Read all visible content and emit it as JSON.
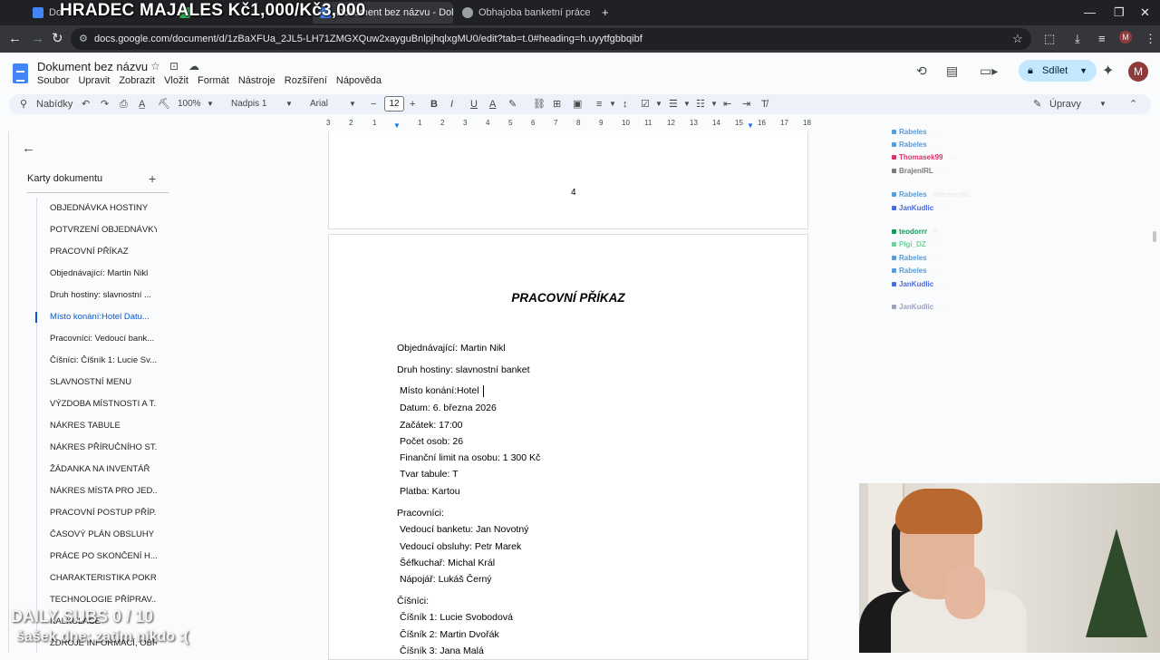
{
  "overlays": {
    "top_banner": "HRADEC MAJALES Kč1,000/Kč3,000",
    "daily_subs": "DAILY SUBS 0 / 10",
    "sasek": "šašek dne: zatím nikdo :("
  },
  "browser": {
    "tabs": [
      {
        "title": "Docu",
        "icon": "docs-icon",
        "active": false
      },
      {
        "title": "",
        "icon": "docs-icon",
        "active": false
      },
      {
        "title": "Dokument bez názvu - Dokum",
        "icon": "docs-icon",
        "active": true
      },
      {
        "title": "Obhajoba banketní práce",
        "icon": "globe-icon",
        "active": false
      }
    ],
    "new_tab": "+",
    "url": "docs.google.com/document/d/1zBaXFUa_2JL5-LH71ZMGXQuw2xayguBnlpjhqlxgMU0/edit?tab=t.0#heading=h.uyytfgbbqibf"
  },
  "docs": {
    "title": "Dokument bez názvu",
    "menu": [
      "Soubor",
      "Upravit",
      "Zobrazit",
      "Vložit",
      "Formát",
      "Nástroje",
      "Rozšíření",
      "Nápověda"
    ],
    "share_label": "Sdílet",
    "avatar_initial": "M",
    "toolbar": {
      "search_label": "Nabídky",
      "zoom": "100%",
      "style": "Nadpis 1",
      "font": "Arial",
      "font_size": "12",
      "mode": "Úpravy"
    },
    "ruler_ticks": [
      "3",
      "2",
      "1",
      "1",
      "2",
      "3",
      "4",
      "5",
      "6",
      "7",
      "8",
      "9",
      "10",
      "11",
      "12",
      "13",
      "14",
      "15",
      "16",
      "17",
      "18"
    ]
  },
  "outline": {
    "title": "Karty dokumentu",
    "items": [
      "OBJEDNÁVKA HOSTINY",
      "POTVRZENÍ OBJEDNÁVKY",
      "PRACOVNÍ PŘÍKAZ",
      "Objednávající: Martin Nikl",
      "Druh hostiny: slavnostní ...",
      "Místo konání:Hotel Datu...",
      "Pracovníci: Vedoucí bank...",
      "Číšníci: Číšník 1: Lucie Sv...",
      "SLAVNOSTNÍ MENU",
      "VÝZDOBA MÍSTNOSTI A T...",
      "NÁKRES TABULE",
      "NÁKRES PŘÍRUČNÍHO ST...",
      "ŽÁDANKA NA INVENTÁŘ",
      "NÁKRES MÍSTA PRO JED...",
      "PRACOVNÍ POSTUP PŘÍP...",
      "ČASOVÝ PLÁN OBSLUHY",
      "PRÁCE PO SKONČENÍ H...",
      "CHARAKTERISTIKA POKR...",
      "TECHNOLOGIE PŘÍPRAV...",
      "KALKULACE",
      "ZDROJE INFORMACÍ, OBR..."
    ],
    "active_index": 5
  },
  "document": {
    "page_number": "4",
    "heading": "PRACOVNÍ PŘÍKAZ",
    "lines": [
      "Objednávající: Martin Nikl",
      "Druh hostiny: slavnostní banket",
      "Místo konání:Hotel",
      "Datum: 6. března 2026",
      "Začátek: 17:00",
      "Počet osob: 26",
      "Finanční limit na osobu: 1 300 Kč",
      "Tvar tabule: T",
      "Platba: Kartou",
      "Pracovníci:",
      "Vedoucí banketu: Jan Novotný",
      "Vedoucí obsluhy: Petr Marek",
      "Šéfkuchař: Michal Král",
      "Nápojář: Lukáš Černý",
      "Číšníci:",
      "Číšník 1: Lucie Svobodová",
      "Číšník 2: Martin Dvořák",
      "Číšník 3: Jana Malá"
    ]
  },
  "chat": [
    {
      "user": "Rabeles",
      "color": "#5b9bd5",
      "text": "..."
    },
    {
      "user": "Rabeles",
      "color": "#5b9bd5",
      "text": "..."
    },
    {
      "user": "Thomasek99",
      "color": "#d6336c",
      "text": "..."
    },
    {
      "user": "BrajenIRL",
      "color": "#7a7a7a",
      "text": "..."
    },
    {
      "user": "Rabeles",
      "color": "#5b9bd5",
      "text": "@BrajenIRL"
    },
    {
      "user": "JanKudlic",
      "color": "#4b6cd8",
      "text": "..."
    },
    {
      "user": "teodorrr",
      "color": "#0f9d58",
      "text": "‼"
    },
    {
      "user": "Pigi_DZ",
      "color": "#6fcf97",
      "text": "..."
    },
    {
      "user": "Rabeles",
      "color": "#5b9bd5",
      "text": "..."
    },
    {
      "user": "Rabeles",
      "color": "#5b9bd5",
      "text": "..."
    },
    {
      "user": "JanKudlic",
      "color": "#4b6cd8",
      "text": "..."
    },
    {
      "user": "JanKudlic",
      "color": "#a0a0c0",
      "text": "..."
    }
  ]
}
